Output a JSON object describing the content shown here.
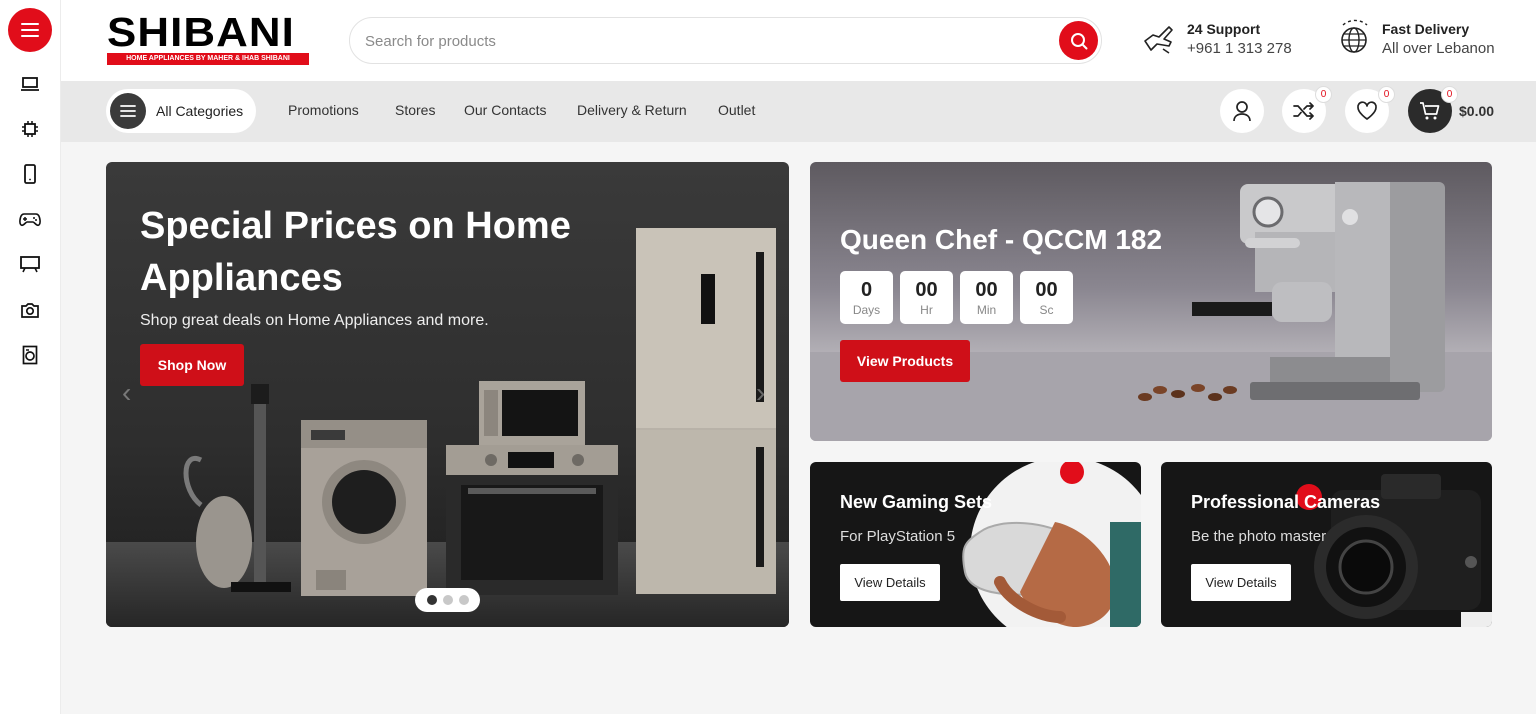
{
  "brand": {
    "name": "SHIBANI",
    "tagline": "HOME APPLIANCES BY MAHER & IHAB SHIBANI",
    "accent_color": "#e10d1a"
  },
  "rail": {
    "items": [
      {
        "icon": "menu-icon"
      },
      {
        "icon": "laptop-icon"
      },
      {
        "icon": "chip-icon"
      },
      {
        "icon": "mobile-icon"
      },
      {
        "icon": "gamepad-icon"
      },
      {
        "icon": "monitor-icon"
      },
      {
        "icon": "camera-icon"
      },
      {
        "icon": "washing-machine-icon"
      }
    ]
  },
  "search": {
    "placeholder": "Search for products",
    "icon": "search-icon"
  },
  "support": {
    "title": "24 Support",
    "phone": "+961 1 313 278",
    "icon": "phone-hand-icon"
  },
  "delivery": {
    "title": "Fast Delivery",
    "subtitle": "All over Lebanon",
    "icon": "globe-icon"
  },
  "nav": {
    "all_categories": "All Categories",
    "links": [
      "Promotions",
      "Stores",
      "Our Contacts",
      "Delivery & Return",
      "Outlet"
    ]
  },
  "actions": {
    "compare_count": "0",
    "wishlist_count": "0",
    "cart_count": "0",
    "cart_total": "$0.00"
  },
  "hero": {
    "title": "Special Prices on Home Appliances",
    "subtitle": "Shop great deals on Home Appliances and more.",
    "button": "Shop Now",
    "active_slide": 1,
    "slide_count": 3
  },
  "promo": {
    "title": "Queen Chef - QCCM 182",
    "countdown": [
      {
        "value": "0",
        "label": "Days"
      },
      {
        "value": "00",
        "label": "Hr"
      },
      {
        "value": "00",
        "label": "Min"
      },
      {
        "value": "00",
        "label": "Sc"
      }
    ],
    "button": "View Products"
  },
  "banners": [
    {
      "title": "New Gaming Sets",
      "subtitle": "For PlayStation 5",
      "button": "View Details"
    },
    {
      "title": "Professional Cameras",
      "subtitle": "Be the photo master",
      "button": "View Details"
    }
  ]
}
